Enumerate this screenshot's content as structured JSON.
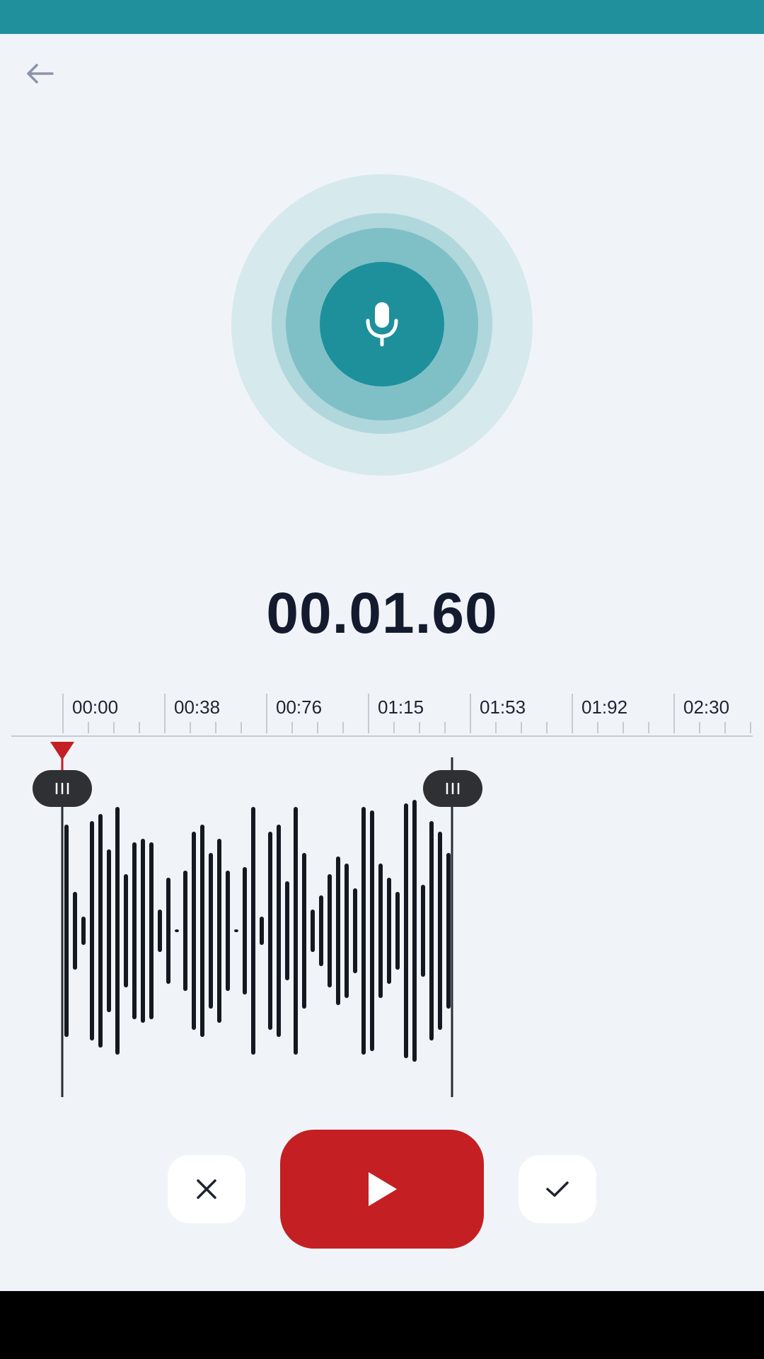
{
  "colors": {
    "accent": "#1d909c",
    "record_red": "#c41f23",
    "background": "#f0f4f9",
    "text_dark": "#141b2e",
    "waveform_bar": "#141820"
  },
  "header": {
    "back_icon": "arrow-left-icon"
  },
  "recorder": {
    "mic_icon": "microphone-icon",
    "timer": "00.01.60"
  },
  "timeline": {
    "labels": [
      "00:00",
      "00:38",
      "00:76",
      "01:15",
      "01:53",
      "01:92",
      "02:30"
    ]
  },
  "controls": {
    "cancel_icon": "close-icon",
    "play_icon": "play-icon",
    "confirm_icon": "check-icon"
  }
}
